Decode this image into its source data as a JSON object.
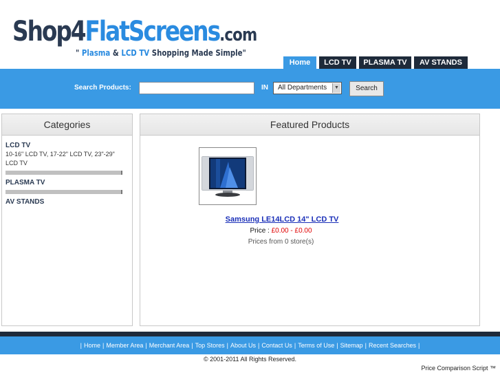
{
  "header": {
    "logo_part1": "Shop4",
    "logo_part2": "FlatScreens",
    "logo_part3": ".com",
    "tagline_open": "\" ",
    "tagline_1": "Plasma",
    "tagline_2": " & ",
    "tagline_3": "LCD TV",
    "tagline_4": " Shopping Made Simple",
    "tagline_close": "\""
  },
  "tabs": [
    {
      "label": "Home",
      "active": true
    },
    {
      "label": "LCD TV"
    },
    {
      "label": "PLASMA TV"
    },
    {
      "label": "AV STANDS"
    }
  ],
  "search": {
    "label": "Search Products:",
    "value": "",
    "in_label": "IN",
    "department": "All Departments",
    "button": "Search"
  },
  "categories": {
    "title": "Categories",
    "items": [
      {
        "name": "LCD TV",
        "sub": "10-16\" LCD TV, 17-22\" LCD TV, 23\"-29\" LCD TV"
      },
      {
        "name": "PLASMA TV"
      },
      {
        "name": "AV STANDS"
      }
    ]
  },
  "featured": {
    "title": "Featured Products",
    "product": {
      "name": "Samsung LE14LCD 14\" LCD TV",
      "price_label": "Price : ",
      "price_value": "£0.00 - £0.00",
      "stores": "Prices from 0 store(s)"
    }
  },
  "footer": {
    "links": [
      "Home",
      "Member Area",
      "Merchant Area",
      "Top Stores",
      "About Us",
      "Contact Us",
      "Terms of Use",
      "Sitemap",
      "Recent Searches"
    ],
    "copyright": "© 2001-2011  All Rights Reserved.",
    "credit": "Price Comparison Script ™"
  },
  "colors": {
    "accent": "#3a9ae4",
    "navy": "#1e2a3a",
    "link": "#1a2fb8",
    "price": "#e00000"
  }
}
